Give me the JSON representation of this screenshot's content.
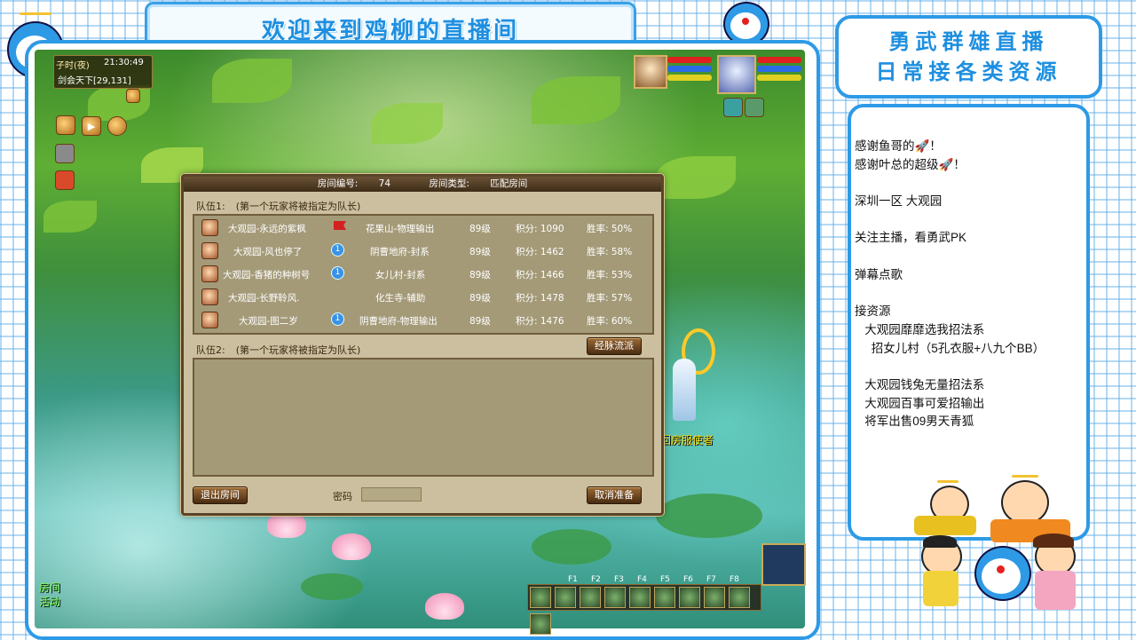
{
  "title_banner": "欢迎来到鸡柳的直播间",
  "right_banner": {
    "line1": "勇武群雄直播",
    "line2": "日常接各类资源"
  },
  "notes": [
    "感谢鱼哥的🚀！",
    "感谢叶总的超级🚀！",
    "",
    "深圳一区 大观园",
    "",
    "关注主播，看勇武PK",
    "",
    "弹幕点歌",
    "",
    "接资源",
    "   大观园靡靡选我招法系",
    "     招女儿村（5孔衣服+八九个BB）",
    "",
    "   大观园钱兔无量招法系",
    "   大观园百事可爱招输出",
    "   将军出售09男天青狐"
  ],
  "hud": {
    "time_label": "子时(夜)",
    "clock": "21:30:49",
    "location": "剑会天下[29,131]"
  },
  "hotbar_keys": [
    "F1",
    "F2",
    "F3",
    "F4",
    "F5",
    "F6",
    "F7",
    "F8"
  ],
  "npc_name": "回房服使者",
  "side_labels": {
    "room": "房间",
    "activity": "活动"
  },
  "dialog": {
    "room_number_label": "房间编号:",
    "room_number": "74",
    "room_type_label": "房间类型:",
    "room_type": "匹配房间",
    "team1_label": "队伍1:",
    "team1_hint": "(第一个玩家将被指定为队长)",
    "team2_label": "队伍2:",
    "team2_hint": "(第一个玩家将被指定为队长)",
    "team1": [
      {
        "name": "大观园-永远的紫枫",
        "marker": "flag",
        "school": "花果山-物理输出",
        "level": "89级",
        "score": "积分: 1090",
        "winrate": "胜率: 50%"
      },
      {
        "name": "大观园-风也停了",
        "marker": "1",
        "school": "阴曹地府-封系",
        "level": "89级",
        "score": "积分: 1462",
        "winrate": "胜率: 58%"
      },
      {
        "name": "大观园-香猪的种树号",
        "marker": "1",
        "school": "女儿村-封系",
        "level": "89级",
        "score": "积分: 1466",
        "winrate": "胜率: 53%"
      },
      {
        "name": "大观园-长野聆风.",
        "marker": "",
        "school": "化生寺-辅助",
        "level": "89级",
        "score": "积分: 1478",
        "winrate": "胜率: 57%"
      },
      {
        "name": "大观园-图二岁",
        "marker": "1",
        "school": "阴曹地府-物理输出",
        "level": "89级",
        "score": "积分: 1476",
        "winrate": "胜率: 60%"
      }
    ],
    "meridian_button": "经脉流派",
    "exit_button": "退出房间",
    "password_label": "密码",
    "cancel_ready_button": "取消准备"
  },
  "colors": {
    "frame_blue": "#2e9ae6",
    "dialog_bg": "#ccbf9f",
    "npc_name": "#ffd800"
  }
}
